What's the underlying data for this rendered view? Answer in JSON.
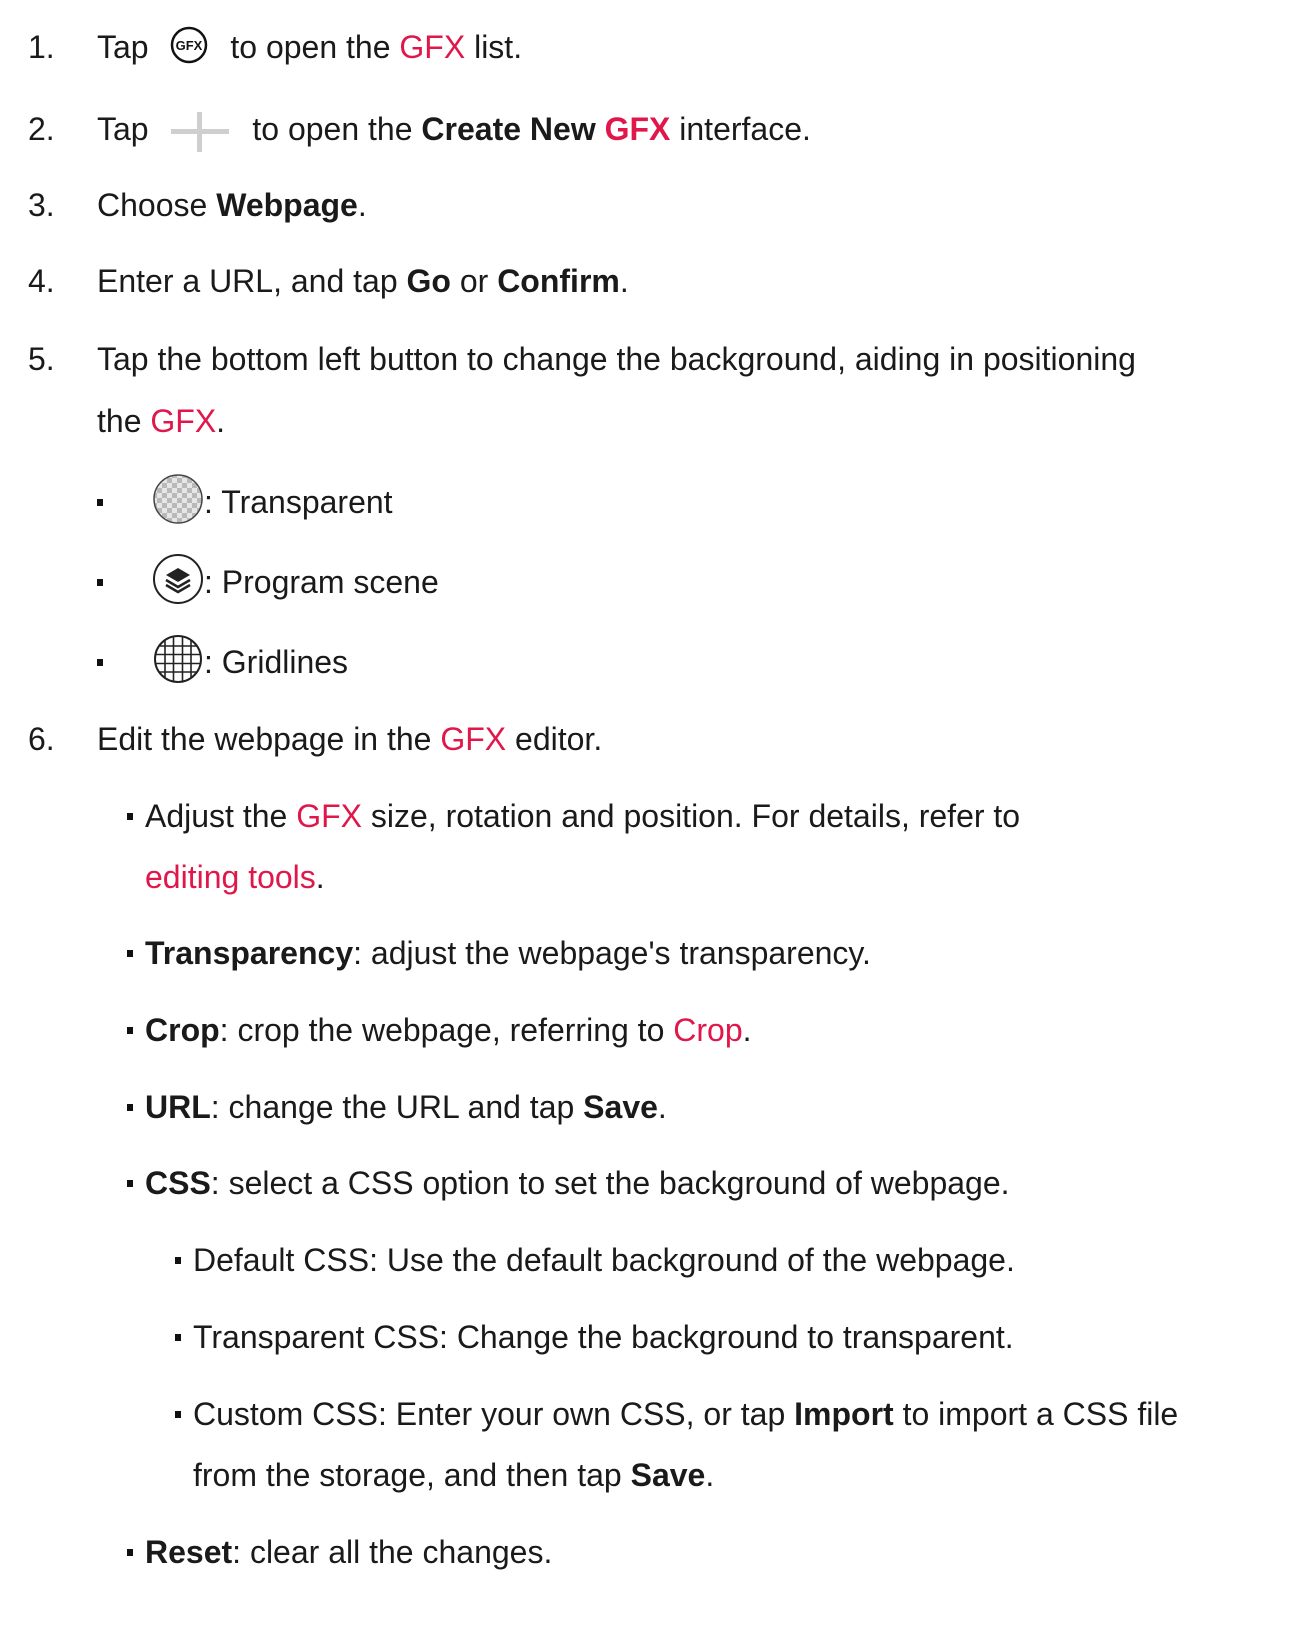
{
  "steps": [
    {
      "num": "1.",
      "pre": "Tap",
      "icon": "gfx-icon",
      "post": "to open the",
      "link": "GFX",
      "end": "list."
    },
    {
      "num": "2.",
      "pre": "Tap",
      "icon": "plus-icon",
      "post": "to open the",
      "bold1": "Create New",
      "bold_red": "GFX",
      "end": "interface."
    },
    {
      "num": "3.",
      "pre": "Choose",
      "bold": "Webpage",
      "end": "."
    },
    {
      "num": "4.",
      "pre": "Enter a URL, and tap",
      "bold1": "Go",
      "mid": "or",
      "bold2": "Confirm",
      "end": "."
    },
    {
      "num": "5.",
      "line1": "Tap the bottom left button to change the background, aiding in positioning",
      "line2_pre": "the",
      "link": "GFX",
      "end": "."
    },
    {
      "num": "6.",
      "pre": "Edit the webpage in the",
      "link": "GFX",
      "end": "editor."
    }
  ],
  "backgrounds": [
    {
      "icon": "transparent-checker-icon",
      "label": ": Transparent"
    },
    {
      "icon": "layers-icon",
      "label": ": Program scene"
    },
    {
      "icon": "grid-icon",
      "label": ": Gridlines"
    }
  ],
  "editor": {
    "adjust": {
      "pre": "Adjust the",
      "link": "GFX",
      "post": "size, rotation and position. For details, refer to",
      "link2": "editing tools",
      "end": "."
    },
    "transparency": {
      "term": "Transparency",
      "desc": ": adjust the webpage's transparency."
    },
    "crop": {
      "term": "Crop",
      "desc": ": crop the webpage, referring to",
      "link": "Crop",
      "end": "."
    },
    "url": {
      "term": "URL",
      "desc": ": change the URL and tap",
      "bold": "Save",
      "end": "."
    },
    "css": {
      "term": "CSS",
      "desc": ": select a CSS option to set the background of webpage."
    },
    "css_options": {
      "default": "Default CSS: Use the default background of the webpage.",
      "transparent": "Transparent CSS: Change the background to transparent.",
      "custom_pre": "Custom CSS: Enter your own CSS, or tap",
      "custom_bold": "Import",
      "custom_post": "to import a CSS file",
      "custom_line2_pre": "from the storage, and then tap",
      "custom_bold2": "Save",
      "custom_end": "."
    },
    "reset": {
      "term": "Reset",
      "desc": ": clear all the changes."
    }
  }
}
